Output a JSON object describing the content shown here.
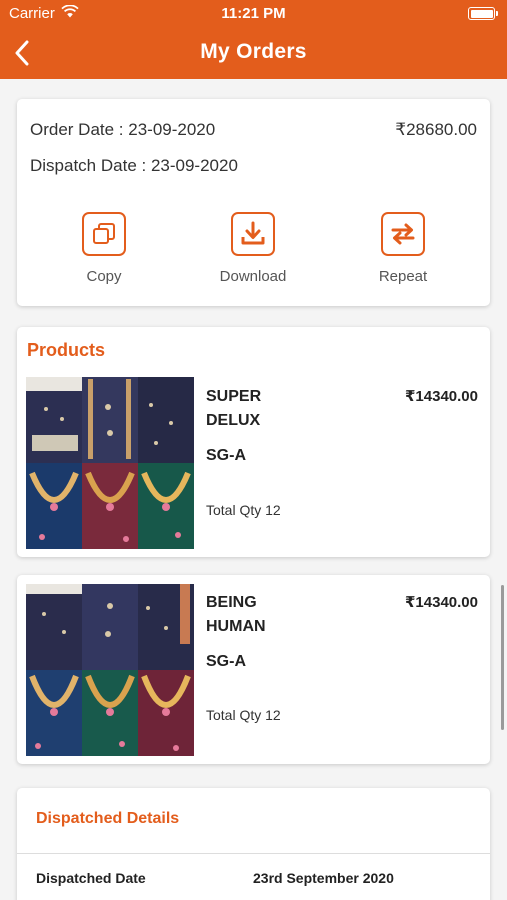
{
  "status_bar": {
    "carrier": "Carrier",
    "time": "11:21 PM"
  },
  "nav": {
    "title": "My Orders"
  },
  "order": {
    "order_date": "Order Date : 23-09-2020",
    "amount": "₹28680.00",
    "dispatch_date": "Dispatch Date : 23-09-2020",
    "actions": [
      {
        "label": "Copy",
        "icon": "copy-icon"
      },
      {
        "label": "Download",
        "icon": "download-icon"
      },
      {
        "label": "Repeat",
        "icon": "repeat-icon"
      }
    ]
  },
  "products": {
    "heading": "Products",
    "items": [
      {
        "name": "SUPER DELUX",
        "price": "₹14340.00",
        "code": "SG-A",
        "qty": "Total Qty 12"
      },
      {
        "name": "BEING HUMAN",
        "price": "₹14340.00",
        "code": "SG-A",
        "qty": "Total Qty 12"
      }
    ]
  },
  "dispatch": {
    "heading": "Dispatched Details",
    "rows": [
      {
        "label": "Dispatched Date",
        "value": "23rd September  2020"
      }
    ]
  },
  "colors": {
    "accent": "#e35d1c",
    "background": "#f4f4f4"
  }
}
